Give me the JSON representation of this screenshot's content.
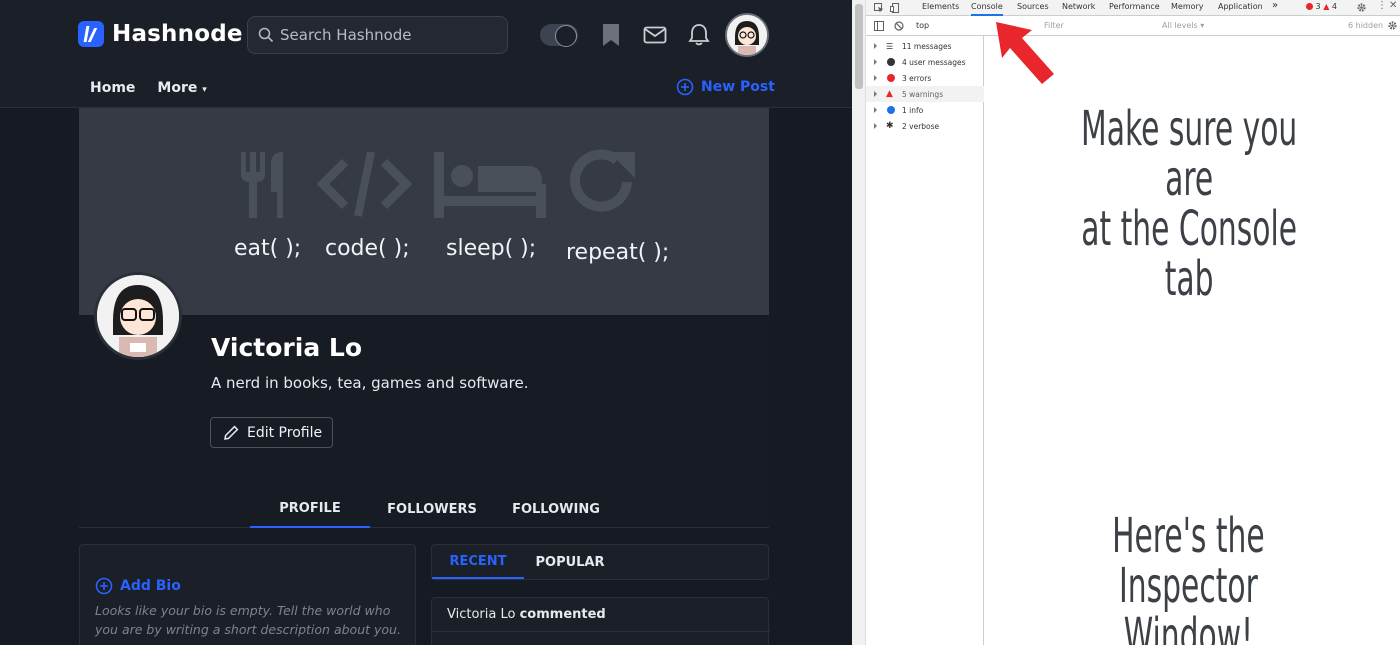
{
  "header": {
    "logo_text": "Hashnode",
    "search_placeholder": "Search Hashnode",
    "nav": [
      "Home",
      "More"
    ],
    "new_post": "New Post"
  },
  "banner": {
    "words": [
      "eat( );",
      "code( );",
      "sleep( );",
      "repeat( );"
    ]
  },
  "profile": {
    "name": "Victoria Lo",
    "bio": "A nerd in books, tea, games and software.",
    "edit_button": "Edit Profile",
    "tabs": [
      "PROFILE",
      "FOLLOWERS",
      "FOLLOWING"
    ],
    "active_tab": "PROFILE"
  },
  "bio_box": {
    "add_bio": "Add Bio",
    "empty_text": "Looks like your bio is empty. Tell the world who you are by writing a short description about you."
  },
  "feed": {
    "tabs": [
      "RECENT",
      "POPULAR"
    ],
    "active_tab": "RECENT",
    "item_user": "Victoria Lo",
    "item_action": "commented"
  },
  "devtools": {
    "tabs": [
      "Elements",
      "Console",
      "Sources",
      "Network",
      "Performance",
      "Memory",
      "Application"
    ],
    "active_tab": "Console",
    "more": "»",
    "error_count": "3",
    "warning_count": "4",
    "context": "top",
    "filter_placeholder": "Filter",
    "levels": "All levels ▾",
    "hidden": "6 hidden",
    "messages": [
      {
        "label": "11 messages",
        "kind": "list"
      },
      {
        "label": "4 user messages",
        "kind": "user"
      },
      {
        "label": "3 errors",
        "kind": "error"
      },
      {
        "label": "5 warnings",
        "kind": "warning"
      },
      {
        "label": "1 info",
        "kind": "info"
      },
      {
        "label": "2 verbose",
        "kind": "verbose"
      }
    ]
  },
  "annotations": {
    "console_note_line1": "Make sure you are",
    "console_note_line2": "at the Console tab",
    "inspector_note_line1": "Here's the",
    "inspector_note_line2": "Inspector Window!"
  },
  "colors": {
    "accent": "#2962ff",
    "arrow": "#e8262b",
    "error": "#e8262b",
    "info": "#1a73e8"
  }
}
